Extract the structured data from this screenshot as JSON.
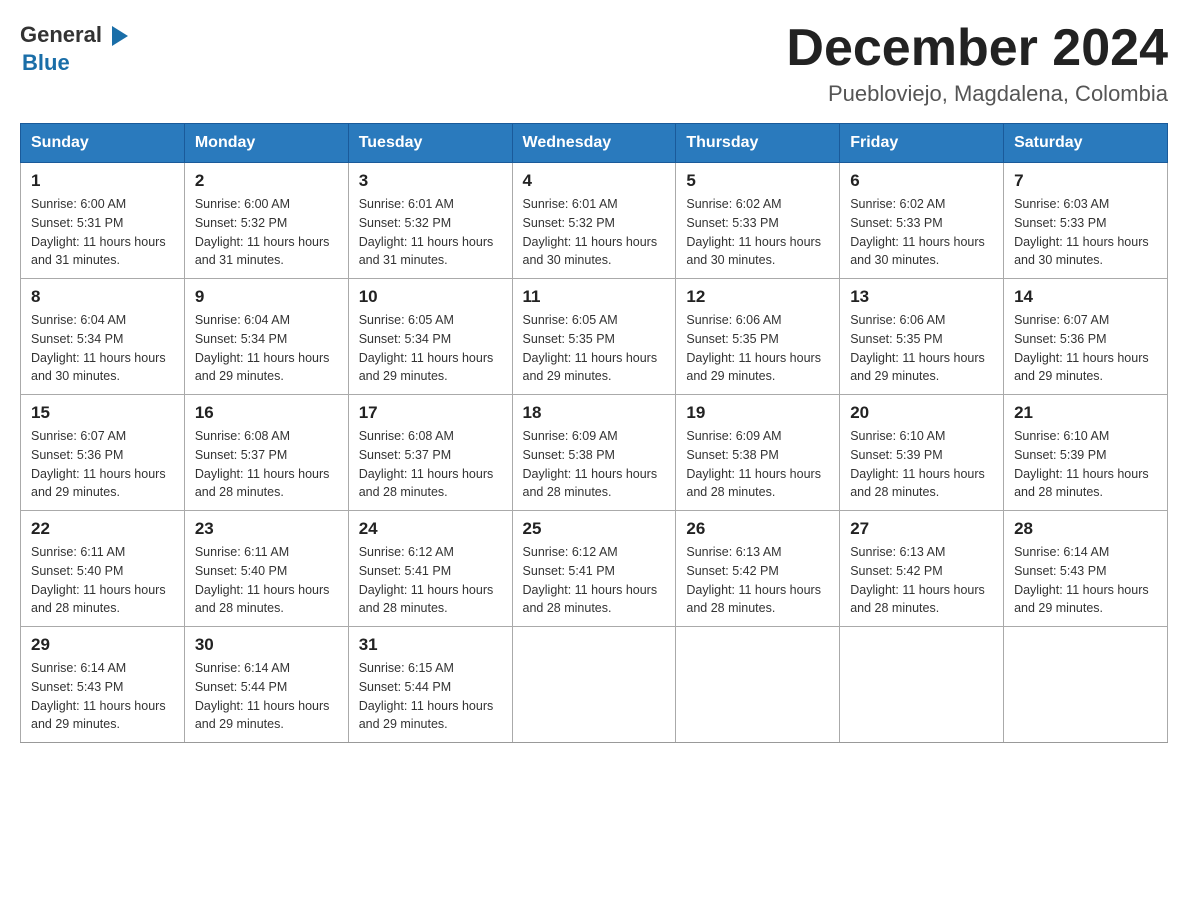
{
  "header": {
    "title": "December 2024",
    "subtitle": "Puebloviejo, Magdalena, Colombia",
    "logo": {
      "general": "General",
      "blue": "Blue"
    }
  },
  "days": [
    "Sunday",
    "Monday",
    "Tuesday",
    "Wednesday",
    "Thursday",
    "Friday",
    "Saturday"
  ],
  "weeks": [
    [
      {
        "day": "1",
        "sunrise": "6:00 AM",
        "sunset": "5:31 PM",
        "daylight": "11 hours and 31 minutes."
      },
      {
        "day": "2",
        "sunrise": "6:00 AM",
        "sunset": "5:32 PM",
        "daylight": "11 hours and 31 minutes."
      },
      {
        "day": "3",
        "sunrise": "6:01 AM",
        "sunset": "5:32 PM",
        "daylight": "11 hours and 31 minutes."
      },
      {
        "day": "4",
        "sunrise": "6:01 AM",
        "sunset": "5:32 PM",
        "daylight": "11 hours and 30 minutes."
      },
      {
        "day": "5",
        "sunrise": "6:02 AM",
        "sunset": "5:33 PM",
        "daylight": "11 hours and 30 minutes."
      },
      {
        "day": "6",
        "sunrise": "6:02 AM",
        "sunset": "5:33 PM",
        "daylight": "11 hours and 30 minutes."
      },
      {
        "day": "7",
        "sunrise": "6:03 AM",
        "sunset": "5:33 PM",
        "daylight": "11 hours and 30 minutes."
      }
    ],
    [
      {
        "day": "8",
        "sunrise": "6:04 AM",
        "sunset": "5:34 PM",
        "daylight": "11 hours and 30 minutes."
      },
      {
        "day": "9",
        "sunrise": "6:04 AM",
        "sunset": "5:34 PM",
        "daylight": "11 hours and 29 minutes."
      },
      {
        "day": "10",
        "sunrise": "6:05 AM",
        "sunset": "5:34 PM",
        "daylight": "11 hours and 29 minutes."
      },
      {
        "day": "11",
        "sunrise": "6:05 AM",
        "sunset": "5:35 PM",
        "daylight": "11 hours and 29 minutes."
      },
      {
        "day": "12",
        "sunrise": "6:06 AM",
        "sunset": "5:35 PM",
        "daylight": "11 hours and 29 minutes."
      },
      {
        "day": "13",
        "sunrise": "6:06 AM",
        "sunset": "5:35 PM",
        "daylight": "11 hours and 29 minutes."
      },
      {
        "day": "14",
        "sunrise": "6:07 AM",
        "sunset": "5:36 PM",
        "daylight": "11 hours and 29 minutes."
      }
    ],
    [
      {
        "day": "15",
        "sunrise": "6:07 AM",
        "sunset": "5:36 PM",
        "daylight": "11 hours and 29 minutes."
      },
      {
        "day": "16",
        "sunrise": "6:08 AM",
        "sunset": "5:37 PM",
        "daylight": "11 hours and 28 minutes."
      },
      {
        "day": "17",
        "sunrise": "6:08 AM",
        "sunset": "5:37 PM",
        "daylight": "11 hours and 28 minutes."
      },
      {
        "day": "18",
        "sunrise": "6:09 AM",
        "sunset": "5:38 PM",
        "daylight": "11 hours and 28 minutes."
      },
      {
        "day": "19",
        "sunrise": "6:09 AM",
        "sunset": "5:38 PM",
        "daylight": "11 hours and 28 minutes."
      },
      {
        "day": "20",
        "sunrise": "6:10 AM",
        "sunset": "5:39 PM",
        "daylight": "11 hours and 28 minutes."
      },
      {
        "day": "21",
        "sunrise": "6:10 AM",
        "sunset": "5:39 PM",
        "daylight": "11 hours and 28 minutes."
      }
    ],
    [
      {
        "day": "22",
        "sunrise": "6:11 AM",
        "sunset": "5:40 PM",
        "daylight": "11 hours and 28 minutes."
      },
      {
        "day": "23",
        "sunrise": "6:11 AM",
        "sunset": "5:40 PM",
        "daylight": "11 hours and 28 minutes."
      },
      {
        "day": "24",
        "sunrise": "6:12 AM",
        "sunset": "5:41 PM",
        "daylight": "11 hours and 28 minutes."
      },
      {
        "day": "25",
        "sunrise": "6:12 AM",
        "sunset": "5:41 PM",
        "daylight": "11 hours and 28 minutes."
      },
      {
        "day": "26",
        "sunrise": "6:13 AM",
        "sunset": "5:42 PM",
        "daylight": "11 hours and 28 minutes."
      },
      {
        "day": "27",
        "sunrise": "6:13 AM",
        "sunset": "5:42 PM",
        "daylight": "11 hours and 28 minutes."
      },
      {
        "day": "28",
        "sunrise": "6:14 AM",
        "sunset": "5:43 PM",
        "daylight": "11 hours and 29 minutes."
      }
    ],
    [
      {
        "day": "29",
        "sunrise": "6:14 AM",
        "sunset": "5:43 PM",
        "daylight": "11 hours and 29 minutes."
      },
      {
        "day": "30",
        "sunrise": "6:14 AM",
        "sunset": "5:44 PM",
        "daylight": "11 hours and 29 minutes."
      },
      {
        "day": "31",
        "sunrise": "6:15 AM",
        "sunset": "5:44 PM",
        "daylight": "11 hours and 29 minutes."
      },
      null,
      null,
      null,
      null
    ]
  ],
  "labels": {
    "sunrise": "Sunrise:",
    "sunset": "Sunset:",
    "daylight": "Daylight:"
  }
}
